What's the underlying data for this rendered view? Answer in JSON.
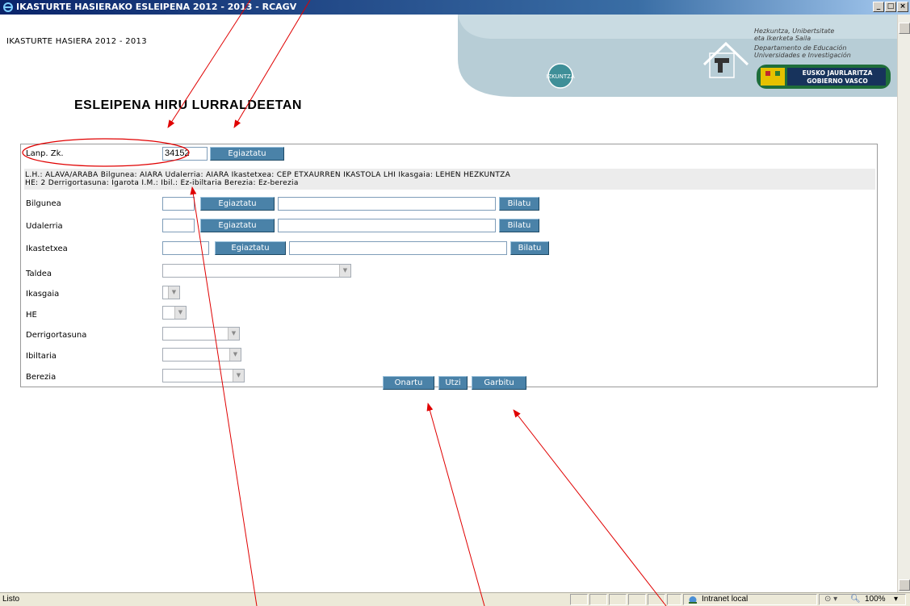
{
  "window": {
    "title": "IKASTURTE HASIERAKO ESLEIPENA 2012 - 2013 - RCAGV",
    "minimize": "_",
    "maximize": "□",
    "close": "×"
  },
  "page": {
    "subtitle": "IKASTURTE HASIERA 2012 - 2013",
    "heading": "ESLEIPENA HIRU LURRALDEETAN"
  },
  "banner": {
    "line1": "Hezkuntza, Unibertsitate",
    "line2": "eta Ikerketa Saila",
    "line3": "Departamento de Educación",
    "line4": "Universidades e Investigación",
    "izkuntza": "IZKUNTZA",
    "gov1": "EUSKO JAURLARITZA",
    "gov2": "GOBIERNO VASCO"
  },
  "form": {
    "lanp": {
      "label": "Lanp. Zk.",
      "value": "34152",
      "button": "Egiaztatu"
    },
    "info_line1": "L.H.: ALAVA/ARABA  Bilgunea: AIARA  Udalerria: AIARA  Ikastetxea: CEP ETXAURREN IKASTOLA LHI  Ikasgaia:  LEHEN HEZKUNTZA",
    "info_line2": "HE: 2  Derrigortasuna: Igarota  I.M.:   Ibil.: Ez-ibiltaria  Berezia: Ez-berezia",
    "bilgunea": {
      "label": "Bilgunea",
      "button": "Egiaztatu",
      "search": "Bilatu"
    },
    "udalerria": {
      "label": "Udalerria",
      "button": "Egiaztatu",
      "search": "Bilatu"
    },
    "ikastetxea": {
      "label": "Ikastetxea",
      "button": "Egiaztatu",
      "search": "Bilatu"
    },
    "taldea": {
      "label": "Taldea"
    },
    "ikasgaia": {
      "label": "Ikasgaia"
    },
    "he": {
      "label": "HE"
    },
    "derrigortasuna": {
      "label": "Derrigortasuna"
    },
    "ibiltaria": {
      "label": "Ibiltaria"
    },
    "berezia": {
      "label": "Berezia"
    },
    "actions": {
      "accept": "Onartu",
      "cancel": "Utzi",
      "clear": "Garbitu"
    }
  },
  "statusbar": {
    "status": "Listo",
    "zone": "Intranet local",
    "zoom": "100%"
  },
  "colors": {
    "button": "#4a82a8",
    "titlebar": "#0a246a",
    "annotation": "#e00000"
  }
}
